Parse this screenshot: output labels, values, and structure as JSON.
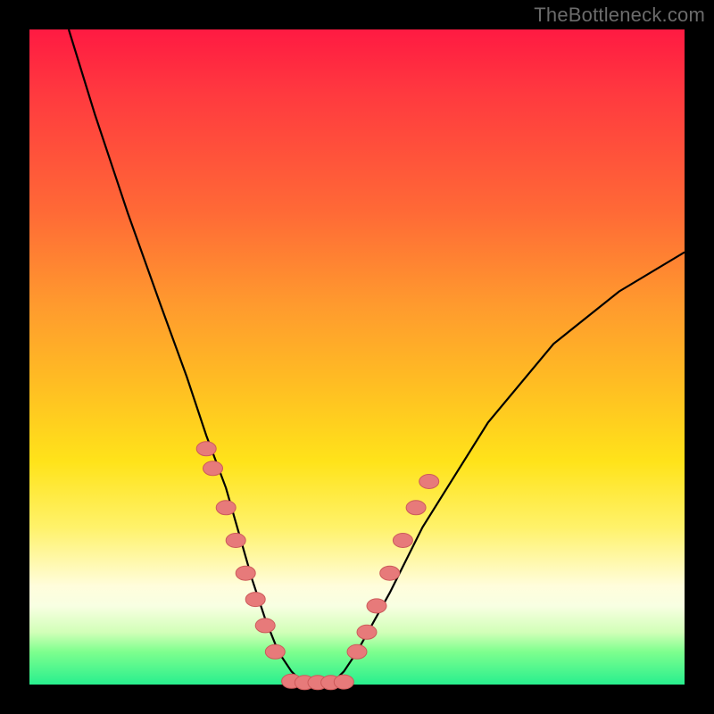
{
  "watermark": "TheBottleneck.com",
  "colors": {
    "frame": "#000000",
    "gradient_top": "#ff1a42",
    "gradient_mid": "#ffe31a",
    "gradient_bottom": "#28ef8e",
    "curve": "#000000",
    "dot_fill": "#e77a7a",
    "dot_stroke": "#cc5a5a"
  },
  "chart_data": {
    "type": "line",
    "title": "",
    "xlabel": "",
    "ylabel": "",
    "xlim": [
      0,
      100
    ],
    "ylim": [
      0,
      100
    ],
    "series": [
      {
        "name": "curve",
        "x": [
          6,
          10,
          15,
          20,
          24,
          27,
          30,
          32,
          34,
          36,
          38,
          40,
          42,
          44,
          46,
          48,
          50,
          55,
          60,
          65,
          70,
          80,
          90,
          100
        ],
        "values": [
          100,
          87,
          72,
          58,
          47,
          38,
          30,
          23,
          16,
          10,
          5,
          2,
          0,
          0,
          0,
          2,
          5,
          14,
          24,
          32,
          40,
          52,
          60,
          66
        ]
      },
      {
        "name": "dots-left",
        "x": [
          27,
          28,
          30,
          31.5,
          33,
          34.5,
          36,
          37.5
        ],
        "values": [
          36,
          33,
          27,
          22,
          17,
          13,
          9,
          5
        ]
      },
      {
        "name": "dots-bottom",
        "x": [
          40,
          42,
          44,
          46,
          48
        ],
        "values": [
          0.5,
          0.3,
          0.3,
          0.3,
          0.4
        ]
      },
      {
        "name": "dots-right",
        "x": [
          50,
          51.5,
          53,
          55,
          57,
          59,
          61
        ],
        "values": [
          5,
          8,
          12,
          17,
          22,
          27,
          31
        ]
      }
    ]
  }
}
